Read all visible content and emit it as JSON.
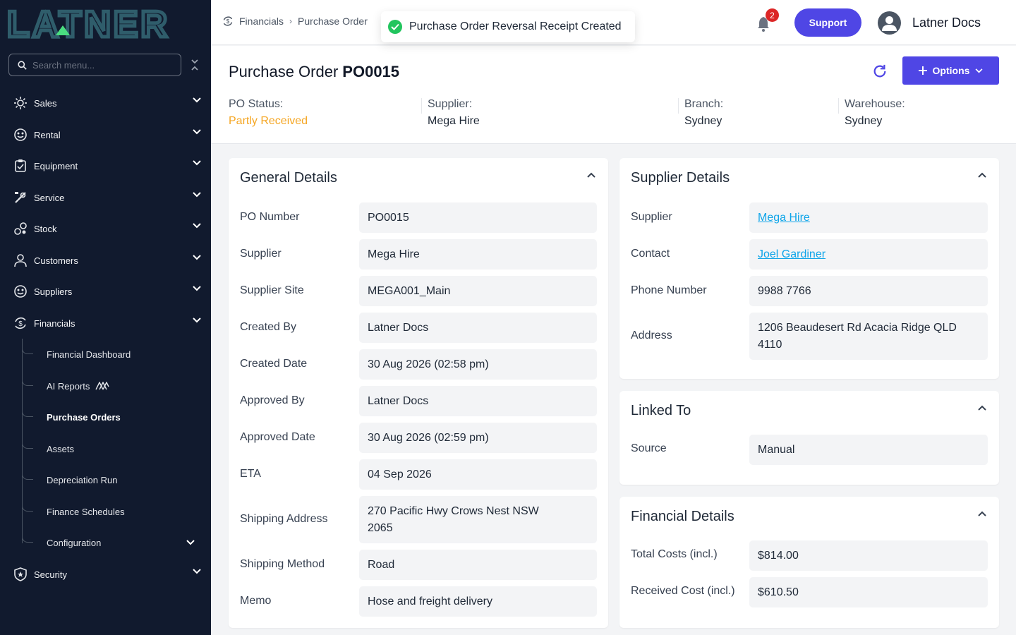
{
  "brand": {
    "logo_text": "LATNER"
  },
  "sidebar": {
    "search_placeholder": "Search menu...",
    "items": [
      {
        "label": "Sales",
        "icon": "sun-icon"
      },
      {
        "label": "Rental",
        "icon": "rental-icon"
      },
      {
        "label": "Equipment",
        "icon": "clipboard-icon"
      },
      {
        "label": "Service",
        "icon": "tools-icon"
      },
      {
        "label": "Stock",
        "icon": "stock-icon"
      },
      {
        "label": "Customers",
        "icon": "user-icon"
      },
      {
        "label": "Suppliers",
        "icon": "supplier-icon"
      },
      {
        "label": "Financials",
        "icon": "financials-icon"
      },
      {
        "label": "Security",
        "icon": "shield-icon"
      }
    ],
    "financials_sub": [
      {
        "label": "Financial Dashboard"
      },
      {
        "label": "AI Reports"
      },
      {
        "label": "Purchase Orders"
      },
      {
        "label": "Assets"
      },
      {
        "label": "Depreciation Run"
      },
      {
        "label": "Finance Schedules"
      },
      {
        "label": "Configuration"
      }
    ]
  },
  "topbar": {
    "breadcrumb": [
      "Financials",
      "Purchase Order"
    ],
    "notification_count": "2",
    "support_label": "Support",
    "user_name": "Latner Docs"
  },
  "toast": {
    "message": "Purchase Order Reversal Receipt Created"
  },
  "header": {
    "title": "Purchase Order",
    "po_number": "PO0015",
    "options_label": "Options",
    "status_fields": [
      {
        "label": "PO Status:",
        "value": "Partly Received"
      },
      {
        "label": "Supplier:",
        "value": "Mega Hire"
      },
      {
        "label": "Branch:",
        "value": "Sydney"
      },
      {
        "label": "Warehouse:",
        "value": "Sydney"
      }
    ]
  },
  "general_details": {
    "title": "General Details",
    "rows": [
      {
        "label": "PO Number",
        "value": "PO0015"
      },
      {
        "label": "Supplier",
        "value": "Mega Hire"
      },
      {
        "label": "Supplier Site",
        "value": "MEGA001_Main"
      },
      {
        "label": "Created By",
        "value": "Latner Docs"
      },
      {
        "label": "Created Date",
        "value": "30 Aug 2026 (02:58 pm)"
      },
      {
        "label": "Approved By",
        "value": "Latner Docs"
      },
      {
        "label": "Approved Date",
        "value": "30 Aug 2026 (02:59 pm)"
      },
      {
        "label": "ETA",
        "value": "04 Sep 2026"
      },
      {
        "label": "Shipping Address",
        "value": "270 Pacific Hwy Crows Nest NSW 2065"
      },
      {
        "label": "Shipping Method",
        "value": "Road"
      },
      {
        "label": "Memo",
        "value": "Hose and freight delivery"
      }
    ]
  },
  "supplier_details": {
    "title": "Supplier Details",
    "rows": [
      {
        "label": "Supplier",
        "value": "Mega Hire"
      },
      {
        "label": "Contact",
        "value": "Joel Gardiner"
      },
      {
        "label": "Phone Number",
        "value": "9988 7766"
      },
      {
        "label": "Address",
        "value": "1206 Beaudesert Rd Acacia Ridge QLD 4110"
      }
    ]
  },
  "linked_to": {
    "title": "Linked To",
    "rows": [
      {
        "label": "Source",
        "value": "Manual"
      }
    ]
  },
  "financial_details": {
    "title": "Financial Details",
    "rows": [
      {
        "label": "Total Costs (incl.)",
        "value": "$814.00"
      },
      {
        "label": "Received Cost (incl.)",
        "value": "$610.50"
      }
    ]
  },
  "colors": {
    "sidebar_bg": "#111a2e",
    "accent": "#4f46e5",
    "status_orange": "#f5a623",
    "link": "#0ea5e9",
    "success": "#22c55e"
  }
}
